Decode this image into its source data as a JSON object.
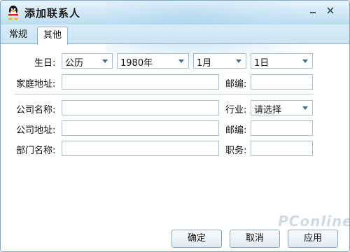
{
  "window": {
    "title": "添加联系人"
  },
  "tabs": [
    {
      "label": "常规",
      "active": false
    },
    {
      "label": "其他",
      "active": true
    }
  ],
  "birthday": {
    "label": "生日:",
    "calendar": "公历",
    "year": "1980年",
    "month": "1月",
    "day": "1日"
  },
  "home_address": {
    "label": "家庭地址:",
    "value": ""
  },
  "home_postcode": {
    "label": "邮编:",
    "value": ""
  },
  "company_name": {
    "label": "公司名称:",
    "value": ""
  },
  "industry": {
    "label": "行业:",
    "value": "请选择"
  },
  "company_address": {
    "label": "公司地址:",
    "value": ""
  },
  "company_postcode": {
    "label": "邮编:",
    "value": ""
  },
  "department": {
    "label": "部门名称:",
    "value": ""
  },
  "position": {
    "label": "职务:",
    "value": ""
  },
  "buttons": {
    "ok": "确定",
    "cancel": "取消",
    "apply": "应用"
  },
  "watermark": "PConline",
  "colors": {
    "accent": "#3f6f93",
    "titlebar": "#cfe6f4",
    "border": "#a9bfd0"
  }
}
